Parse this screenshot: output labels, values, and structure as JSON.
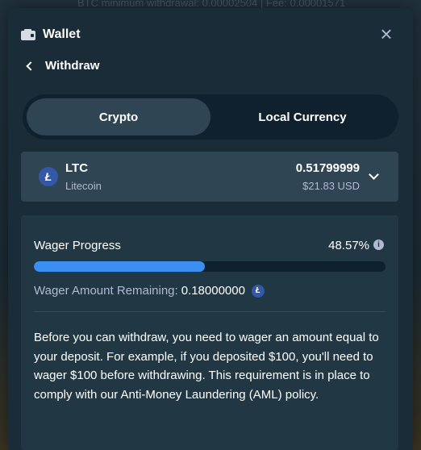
{
  "background": {
    "text": "BTC minimum withdrawal: 0.00002504 | Fee: 0.00001571"
  },
  "header": {
    "title": "Wallet",
    "close_symbol": "×"
  },
  "nav": {
    "back_label": "Withdraw"
  },
  "tabs": [
    {
      "label": "Crypto",
      "active": true
    },
    {
      "label": "Local Currency",
      "active": false
    }
  ],
  "currency": {
    "code": "LTC",
    "name": "Litecoin",
    "amount": "0.51799999",
    "usd": "$21.83 USD",
    "icon_glyph": "Ł"
  },
  "wager": {
    "label": "Wager Progress",
    "value": "48.57%",
    "progress_percent": 48.57,
    "remaining_label": "Wager Amount Remaining:",
    "remaining_value": "0.18000000"
  },
  "note": "Before you can withdraw, you need to wager an amount equal to your deposit. For example, if you deposited $100, you'll need to wager $100 before withdrawing. This requirement is in place to comply with our Anti-Money Laundering (AML) policy.",
  "colors": {
    "accent_progress": "#3b8ff0",
    "panel": "#213743",
    "modal": "#1a2c38",
    "ltc_blue": "#3458a8"
  }
}
